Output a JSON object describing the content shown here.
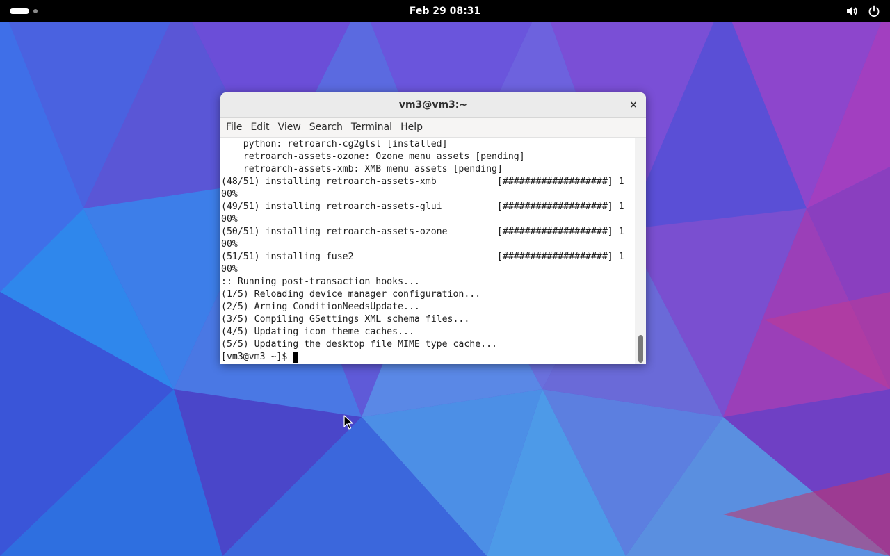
{
  "topbar": {
    "clock": "Feb 29  08:31",
    "workspace_icon": "workspace-indicator-icon",
    "volume_icon": "volume-icon",
    "power_icon": "power-icon"
  },
  "window": {
    "title": "vm3@vm3:~",
    "close_label": "×",
    "menu": [
      "File",
      "Edit",
      "View",
      "Search",
      "Terminal",
      "Help"
    ]
  },
  "terminal": {
    "lines": [
      "    python: retroarch-cg2glsl [installed]",
      "    retroarch-assets-ozone: Ozone menu assets [pending]",
      "    retroarch-assets-xmb: XMB menu assets [pending]",
      "(48/51) installing retroarch-assets-xmb           [###################] 1",
      "00%",
      "(49/51) installing retroarch-assets-glui          [###################] 1",
      "00%",
      "(50/51) installing retroarch-assets-ozone         [###################] 1",
      "00%",
      "(51/51) installing fuse2                          [###################] 1",
      "00%",
      ":: Running post-transaction hooks...",
      "(1/5) Reloading device manager configuration...",
      "(2/5) Arming ConditionNeedsUpdate...",
      "(3/5) Compiling GSettings XML schema files...",
      "(4/5) Updating icon theme caches...",
      "(5/5) Updating the desktop file MIME type cache..."
    ],
    "prompt": "[vm3@vm3 ~]$"
  },
  "colors": {
    "topbar": "#000000",
    "wallpaper_base": "#5a4fd6",
    "terminal_bg": "#ffffff",
    "terminal_fg": "#202020"
  }
}
